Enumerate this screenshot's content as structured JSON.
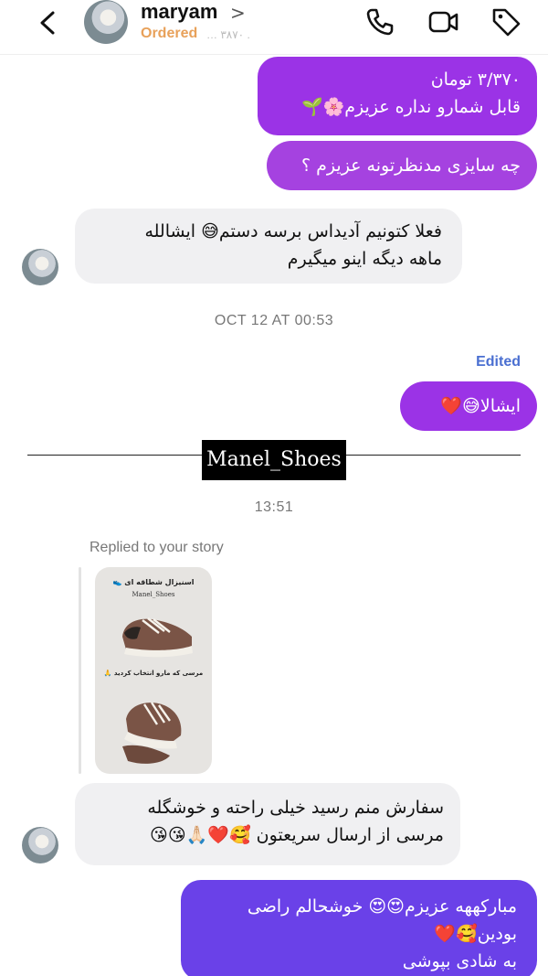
{
  "header": {
    "username": "maryam",
    "username_chevron": ">",
    "status": "Ordered",
    "status_extra": "… ٣٨٧٠ ."
  },
  "messages": [
    {
      "id": "m1",
      "side": "out",
      "line1": "٣/٣٧٠ تومان",
      "line2": "قابل شمارو نداره عزیزم🌸🌱"
    },
    {
      "id": "m2",
      "side": "out",
      "text": "چه سایزی مدنظرتونه عزیزم ؟"
    },
    {
      "id": "m3",
      "side": "in",
      "line1": "فعلا کتونیم آدیداس برسه دستم😅  ایشالله",
      "line2": "ماهه دیگه اینو میگیرم"
    },
    {
      "id": "m4",
      "side": "out",
      "text": "ایشالا😅❤️",
      "edited": "Edited"
    },
    {
      "id": "m5",
      "side": "in",
      "line1": "سفارش منم رسید خیلی راحته و خوشگله",
      "line2": "مرسی از ارسال سریعتون 🥰❤️🙏🏻😘😘"
    },
    {
      "id": "m6",
      "side": "out",
      "line1": "مبارکههه عزیزم😍😍 خوشحالم راضی",
      "line2": "بودین🥰❤️",
      "line3": "به شادی بپوشی"
    }
  ],
  "timestamps": {
    "t1": "OCT 12 AT 00:53",
    "t2": "13:51"
  },
  "watermark": "Manel_Shoes",
  "story_reply": {
    "label": "Replied to your story",
    "story_title": "اسنیزال شطاقه ای 👟",
    "story_brand": "Manel_Shoes",
    "story_caption": "مرسی که مارو انتخاب کردید 🙏"
  },
  "colors": {
    "outgoing": "#9b33e6",
    "outgoing_bottom": "#6a41e8",
    "incoming": "#f0f0f2",
    "status": "#e8a15a",
    "edited": "#4a6fd1"
  },
  "icons": [
    "back-arrow-icon",
    "phone-icon",
    "video-camera-icon",
    "tag-icon"
  ]
}
